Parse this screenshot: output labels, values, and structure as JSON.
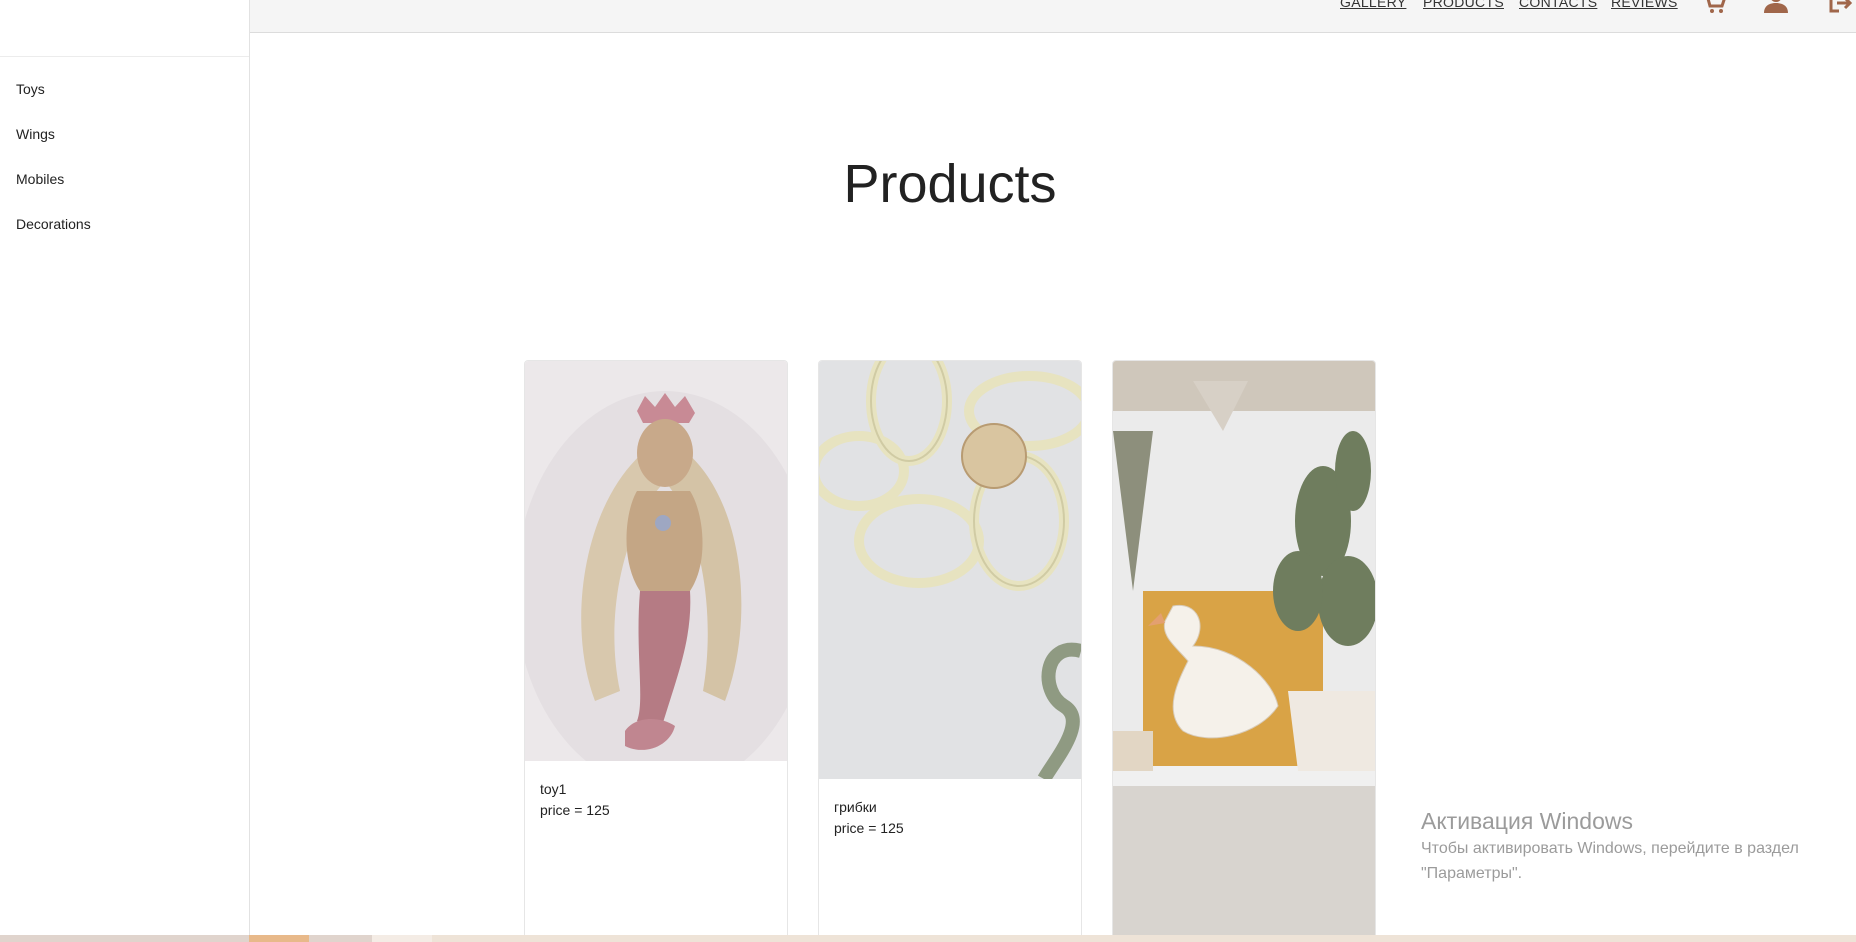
{
  "sidebar": {
    "items": [
      {
        "label": "Toys"
      },
      {
        "label": "Wings"
      },
      {
        "label": "Mobiles"
      },
      {
        "label": "Decorations"
      }
    ]
  },
  "nav": {
    "links": [
      "GALLERY",
      "PRODUCTS",
      "CONTACTS",
      "REVIEWS"
    ],
    "icons": [
      "cart-icon",
      "user-icon",
      "logout-icon"
    ],
    "icon_color": "#a0664a"
  },
  "main": {
    "title": "Products",
    "cards": [
      {
        "name": "toy1",
        "price": "price = 125"
      },
      {
        "name": "грибки",
        "price": "price = 125"
      },
      {
        "name": "",
        "price": ""
      }
    ]
  },
  "watermark": {
    "title": "Активация Windows",
    "line1": "Чтобы активировать Windows, перейдите в раздел",
    "line2": "\"Параметры\"."
  }
}
